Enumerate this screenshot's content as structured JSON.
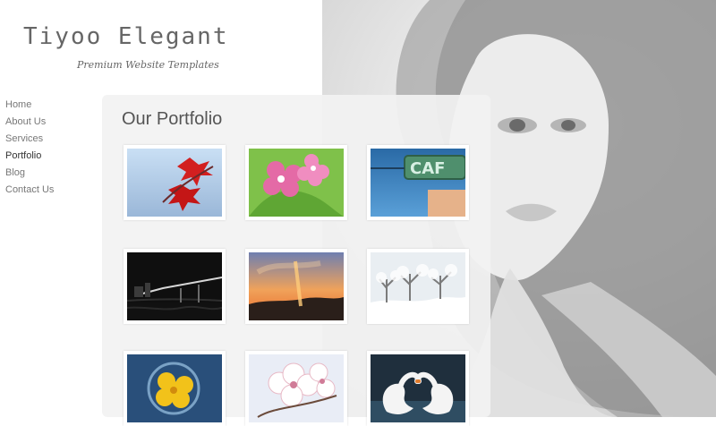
{
  "brand": {
    "title": "Tiyoo Elegant",
    "tagline": "Premium Website Templates"
  },
  "nav": {
    "items": [
      {
        "label": "Home"
      },
      {
        "label": "About Us"
      },
      {
        "label": "Services"
      },
      {
        "label": "Portfolio",
        "active": true
      },
      {
        "label": "Blog"
      },
      {
        "label": "Contact Us"
      }
    ]
  },
  "main": {
    "heading": "Our Portfolio",
    "items": [
      {
        "subject": "red maple leaves on blue sky"
      },
      {
        "subject": "pink flowers with green leaves"
      },
      {
        "subject": "cafe sign on blue sky"
      },
      {
        "subject": "bridge at night"
      },
      {
        "subject": "orange sunset clouds"
      },
      {
        "subject": "snowy trees"
      },
      {
        "subject": "flower bloom on blue background"
      },
      {
        "subject": "white cherry blossoms"
      },
      {
        "subject": "two swans forming heart"
      }
    ]
  },
  "colors": {
    "text_muted": "#777777",
    "text_active": "#333333",
    "panel_bg": "#f2f2f2"
  }
}
